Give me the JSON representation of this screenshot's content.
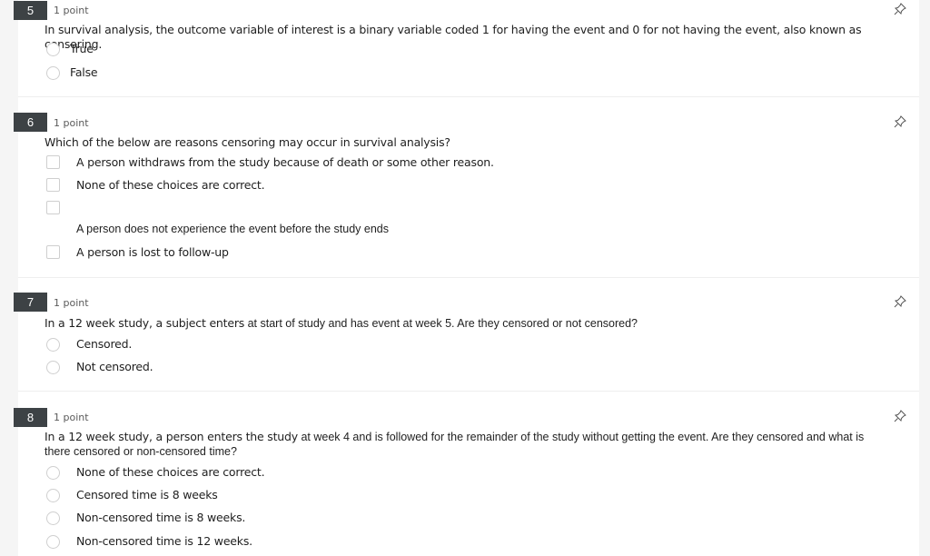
{
  "questions": [
    {
      "number": "5",
      "points": "1 point",
      "prompt": "In survival analysis, the outcome variable of interest is a binary variable coded 1 for having the event and 0 for not having the event, also known as censoring.",
      "options": [
        "True",
        "False"
      ]
    },
    {
      "number": "6",
      "points": "1 point",
      "prompt": "Which of the below are reasons censoring may occur in survival analysis?",
      "options": [
        "A person withdraws from the study because of death or some other reason.",
        "None of these choices are correct.",
        "",
        "A person does not experience the event before the study ends",
        "A person is lost to follow-up"
      ]
    },
    {
      "number": "7",
      "points": "1 point",
      "prompt_a": "In a 12 week study, a subject enters",
      "prompt_b": " at start of study and has event at week 5. Are they censored or not censored?",
      "options": [
        "Censored.",
        "Not censored."
      ]
    },
    {
      "number": "8",
      "points": "1 point",
      "prompt_a": "In a 12 week study, a person enters the study",
      "prompt_b": " at week 4 and is followed for the remainder of the study without getting the event. Are they censored and what is there censored or non-censored time?",
      "options": [
        "None of these choices are correct.",
        "Censored time is 8 weeks",
        "Non-censored time is 8 weeks.",
        "Non-censored time is 12 weeks."
      ]
    }
  ],
  "icons": {
    "pin": "pin-icon",
    "radio": "radio-button",
    "checkbox": "checkbox"
  },
  "colors": {
    "number_badge": "#3d4245",
    "background": "#f5f5f5",
    "card": "#ffffff"
  }
}
